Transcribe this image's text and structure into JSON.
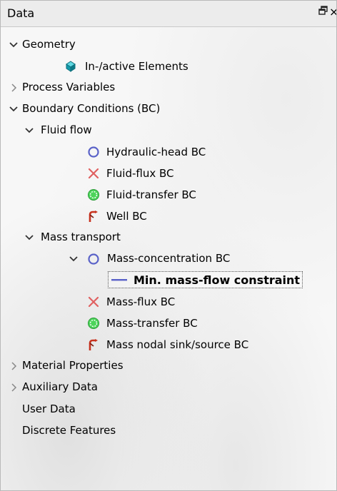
{
  "window": {
    "title": "Data",
    "float_icon": "float-window-icon",
    "close_glyph": "×"
  },
  "tree": {
    "geometry": "Geometry",
    "inactive_elements": "In-/active Elements",
    "process_variables": "Process Variables",
    "boundary_conditions": "Boundary Conditions (BC)",
    "fluid_flow": "Fluid flow",
    "hydraulic_head_bc": "Hydraulic-head BC",
    "fluid_flux_bc": "Fluid-flux BC",
    "fluid_transfer_bc": "Fluid-transfer BC",
    "well_bc": "Well BC",
    "mass_transport": "Mass transport",
    "mass_concentration_bc": "Mass-concentration BC",
    "min_mass_flow_constraint": "Min. mass-flow constraint",
    "mass_flux_bc": "Mass-flux BC",
    "mass_transfer_bc": "Mass-transfer BC",
    "mass_nodal_sink_source_bc": "Mass nodal sink/source BC",
    "material_properties": "Material Properties",
    "auxiliary_data": "Auxiliary Data",
    "user_data": "User Data",
    "discrete_features": "Discrete Features"
  },
  "colors": {
    "hydraulic_circle": "#5a62c8",
    "flux_cross": "#e05c5c",
    "transfer_green": "#3cc04a",
    "well_red": "#c8321e",
    "element_teal": "#18a0b0"
  }
}
